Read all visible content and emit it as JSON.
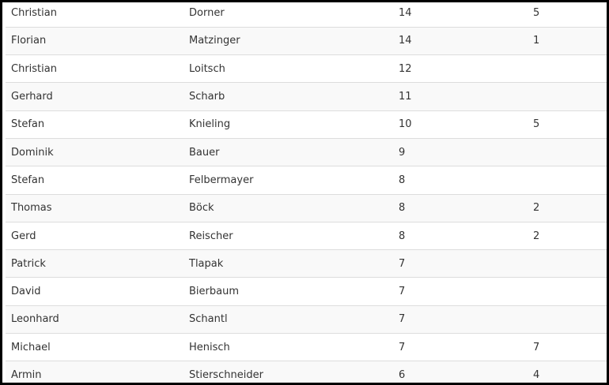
{
  "table": {
    "rows": [
      {
        "first": "Christian",
        "last": "Dorner",
        "value1": "14",
        "value2": "5"
      },
      {
        "first": "Florian",
        "last": "Matzinger",
        "value1": "14",
        "value2": "1"
      },
      {
        "first": "Christian",
        "last": "Loitsch",
        "value1": "12",
        "value2": ""
      },
      {
        "first": "Gerhard",
        "last": "Scharb",
        "value1": "11",
        "value2": ""
      },
      {
        "first": "Stefan",
        "last": "Knieling",
        "value1": "10",
        "value2": "5"
      },
      {
        "first": "Dominik",
        "last": "Bauer",
        "value1": "9",
        "value2": ""
      },
      {
        "first": "Stefan",
        "last": "Felbermayer",
        "value1": "8",
        "value2": ""
      },
      {
        "first": "Thomas",
        "last": "Böck",
        "value1": "8",
        "value2": "2"
      },
      {
        "first": "Gerd",
        "last": "Reischer",
        "value1": "8",
        "value2": "2"
      },
      {
        "first": "Patrick",
        "last": "Tlapak",
        "value1": "7",
        "value2": ""
      },
      {
        "first": "David",
        "last": "Bierbaum",
        "value1": "7",
        "value2": ""
      },
      {
        "first": "Leonhard",
        "last": "Schantl",
        "value1": "7",
        "value2": ""
      },
      {
        "first": "Michael",
        "last": "Henisch",
        "value1": "7",
        "value2": "7"
      },
      {
        "first": "Armin",
        "last": "Stierschneider",
        "value1": "6",
        "value2": "4"
      }
    ]
  }
}
